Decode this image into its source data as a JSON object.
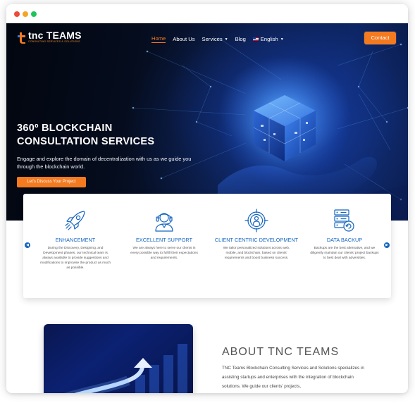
{
  "window": {
    "controls": [
      "close",
      "minimize",
      "maximize"
    ]
  },
  "brand": {
    "logo_main_1": "tnc",
    "logo_main_2": "TEAMS",
    "logo_sub": "CONSULTING SERVICES & SOLUTIONS"
  },
  "nav": {
    "items": [
      {
        "label": "Home",
        "active": true
      },
      {
        "label": "About Us",
        "active": false
      },
      {
        "label": "Services",
        "active": false,
        "dropdown": true
      },
      {
        "label": "Blog",
        "active": false
      },
      {
        "label": "English",
        "active": false,
        "dropdown": true,
        "icon": "us-flag-icon"
      }
    ],
    "contact_label": "Contact"
  },
  "hero": {
    "title_line1": "360º BLOCKCHAIN",
    "title_line2": "CONSULTATION SERVICES",
    "description": "Engage and explore the domain of decentralization with us as we guide you through the blockchain world.",
    "cta_label": "Let's Discuss Your Project"
  },
  "features": [
    {
      "icon": "rocket-icon",
      "title": "ENHANCEMENT",
      "description": "During the Discovery, Designing, and Development phases, our technical team is always available to provide suggestions and modifications to improvise the product as much as possible."
    },
    {
      "icon": "support-agent-icon",
      "title": "EXCELLENT SUPPORT",
      "description": "We are always here to serve our clients in every possible way to fulfill their expectations and requirements."
    },
    {
      "icon": "client-target-icon",
      "title": "CLIENT CENTRIC DEVELOPMENT",
      "description": "We tailor personalized solutions across web, mobile, and blockchain, based on clients' requirements and boost business success."
    },
    {
      "icon": "server-backup-icon",
      "title": "DATA BACKUP",
      "description": "Backups are the best alternative, and we diligently maintain our clients' project backups to best deal with adversities."
    }
  ],
  "carousel": {
    "prev_icon": "chevron-left-icon",
    "next_icon": "chevron-right-icon"
  },
  "about": {
    "title": "ABOUT TNC TEAMS",
    "text": "TNC Teams Blockchain Consulting Services and Solutions specializes in assisting startups and enterprises with the integration of blockchain solutions. We guide our clients' projects,"
  },
  "colors": {
    "accent": "#f47a20",
    "primary_blue": "#1565c0",
    "hero_dark": "#050c1d"
  }
}
